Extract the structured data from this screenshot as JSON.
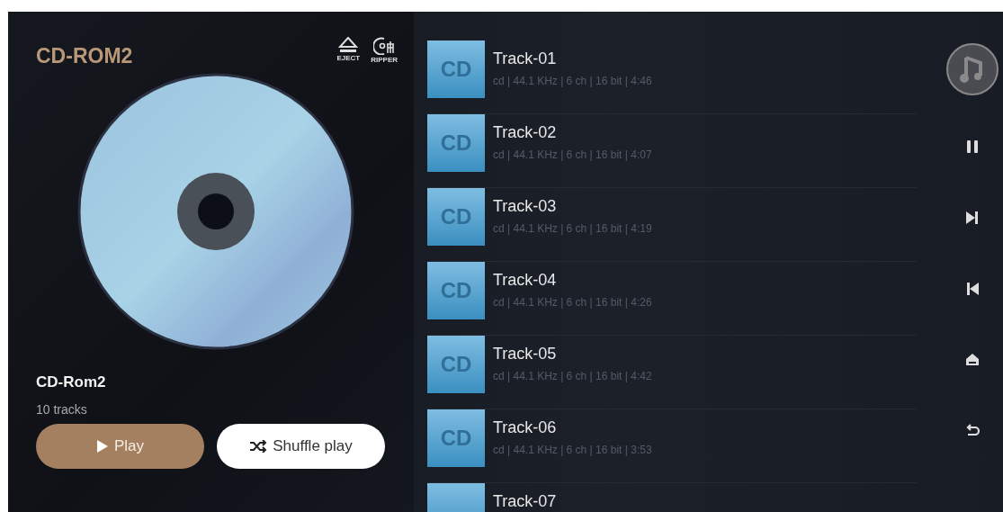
{
  "drive": {
    "title": "CD-ROM2",
    "eject_label": "EJECT",
    "ripper_label": "RIPPER"
  },
  "album": {
    "name": "CD-Rom2",
    "count": "10 tracks"
  },
  "buttons": [
    {
      "kind": "play",
      "label": "Play"
    },
    {
      "kind": "shuffle",
      "label": "Shuffle play"
    }
  ],
  "tracks": [
    {
      "thumb": "CD",
      "title": "Track-01",
      "meta": "cd | 44.1 KHz | 6 ch | 16 bit | 4:46"
    },
    {
      "thumb": "CD",
      "title": "Track-02",
      "meta": "cd | 44.1 KHz | 6 ch | 16 bit | 4:07"
    },
    {
      "thumb": "CD",
      "title": "Track-03",
      "meta": "cd | 44.1 KHz | 6 ch | 16 bit | 4:19"
    },
    {
      "thumb": "CD",
      "title": "Track-04",
      "meta": "cd | 44.1 KHz | 6 ch | 16 bit | 4:26"
    },
    {
      "thumb": "CD",
      "title": "Track-05",
      "meta": "cd | 44.1 KHz | 6 ch | 16 bit | 4:42"
    },
    {
      "thumb": "CD",
      "title": "Track-06",
      "meta": "cd | 44.1 KHz | 6 ch | 16 bit | 3:53"
    },
    {
      "title": "Track-07"
    }
  ],
  "controls": [
    {
      "kind": "pause"
    },
    {
      "kind": "next"
    },
    {
      "kind": "previous"
    },
    {
      "kind": "eject"
    },
    {
      "kind": "back"
    }
  ]
}
